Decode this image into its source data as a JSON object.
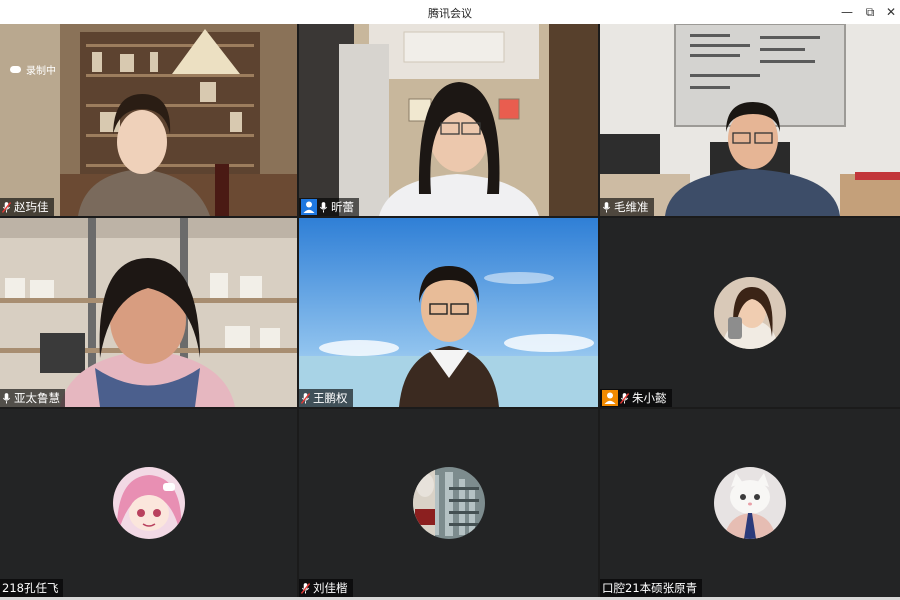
{
  "window": {
    "title": "腾讯会议",
    "minimize_label": "—",
    "restore_label": "⧉",
    "close_label": "✕"
  },
  "status": {
    "recording_label": "录制中"
  },
  "participants": [
    {
      "name": "赵玙佳",
      "mic": "muted",
      "video": "on"
    },
    {
      "name": "昕蕾",
      "mic": "on",
      "video": "on",
      "host": true
    },
    {
      "name": "毛维准",
      "mic": "on",
      "video": "on"
    },
    {
      "name": "亚太鲁慧",
      "mic": "on",
      "video": "on"
    },
    {
      "name": "王鹏权",
      "mic": "muted",
      "video": "on"
    },
    {
      "name": "朱小懿",
      "mic": "muted",
      "video": "off",
      "badge": "orange"
    },
    {
      "name": "218孔任飞",
      "mic": "none",
      "video": "off"
    },
    {
      "name": "刘佳楷",
      "mic": "muted",
      "video": "off"
    },
    {
      "name": "口腔21本硕张原青",
      "mic": "none",
      "video": "off"
    }
  ],
  "colors": {
    "host_badge": "#1f78e0",
    "badge_orange": "#f18a00",
    "grid_background": "#1b1b1b",
    "tile_background": "#232425"
  }
}
